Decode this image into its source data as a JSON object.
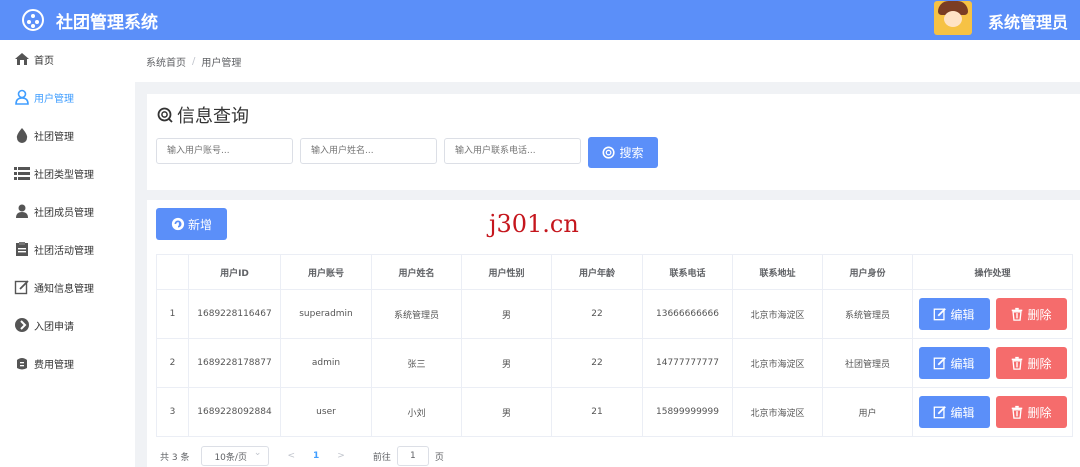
{
  "header": {
    "title": "社团管理系统",
    "admin": "系统管理员"
  },
  "sidebar": {
    "items": [
      {
        "label": "首页",
        "icon": "home-icon"
      },
      {
        "label": "用户管理",
        "icon": "user-icon",
        "active": true
      },
      {
        "label": "社团管理",
        "icon": "drop-icon"
      },
      {
        "label": "社团类型管理",
        "icon": "list-icon"
      },
      {
        "label": "社团成员管理",
        "icon": "member-icon"
      },
      {
        "label": "社团活动管理",
        "icon": "clipboard-icon"
      },
      {
        "label": "通知信息管理",
        "icon": "edit-doc-icon"
      },
      {
        "label": "入团申请",
        "icon": "apply-icon"
      },
      {
        "label": "费用管理",
        "icon": "money-icon"
      }
    ]
  },
  "breadcrumb": {
    "home": "系统首页",
    "separator": "/",
    "current": "用户管理"
  },
  "search": {
    "title": "信息查询",
    "account_placeholder": "输入用户账号...",
    "name_placeholder": "输入用户姓名...",
    "phone_placeholder": "输入用户联系电话...",
    "button": "搜索"
  },
  "toolbar": {
    "add": "新增"
  },
  "watermark": "j301.cn",
  "table": {
    "headers": [
      "",
      "用户ID",
      "用户账号",
      "用户姓名",
      "用户性别",
      "用户年龄",
      "联系电话",
      "联系地址",
      "用户身份",
      "操作处理"
    ],
    "rows": [
      [
        "1",
        "1689228116467",
        "superadmin",
        "系统管理员",
        "男",
        "22",
        "13666666666",
        "北京市海淀区",
        "系统管理员"
      ],
      [
        "2",
        "1689228178877",
        "admin",
        "张三",
        "男",
        "22",
        "14777777777",
        "北京市海淀区",
        "社团管理员"
      ],
      [
        "3",
        "1689228092884",
        "user",
        "小刘",
        "男",
        "21",
        "15899999999",
        "北京市海淀区",
        "用户"
      ]
    ],
    "edit": "编辑",
    "delete": "删除"
  },
  "pagination": {
    "total": "共 3 条",
    "page_size": "10条/页",
    "prev": "<",
    "current": "1",
    "next": ">",
    "goto": "前往",
    "goto_value": "1",
    "unit": "页"
  },
  "colors": {
    "primary": "#5b8ff9",
    "danger": "#f56c6c",
    "link": "#409eff",
    "watermark": "#c5161d"
  }
}
